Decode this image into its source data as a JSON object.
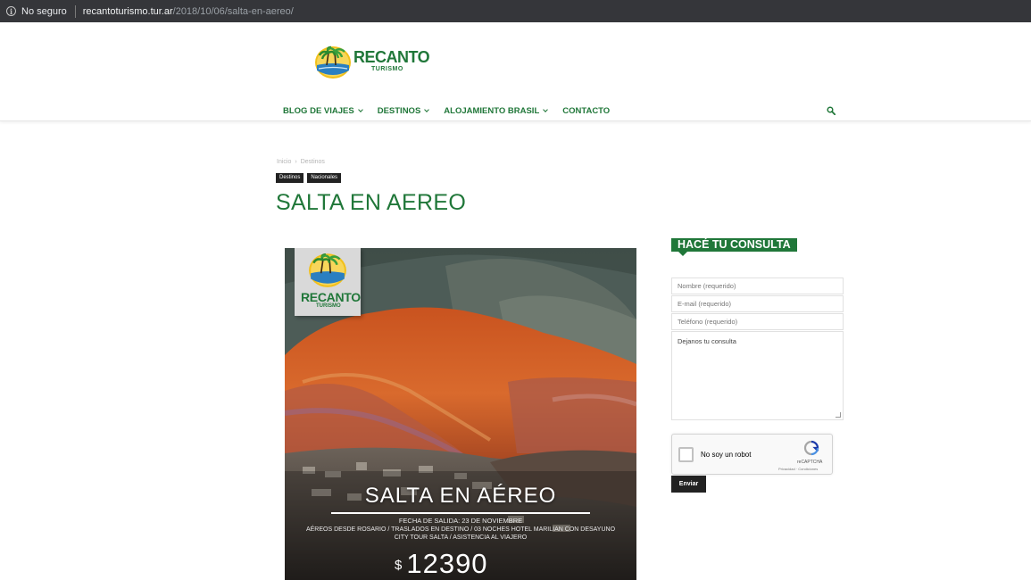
{
  "browser": {
    "security_label": "No seguro",
    "url_host": "recantoturismo.tur.ar",
    "url_path": "/2018/10/06/salta-en-aereo/"
  },
  "header": {
    "logo_word": "RECANTO",
    "logo_sub": "TURISMO",
    "nav": [
      {
        "label": "BLOG DE VIAJES",
        "has_dropdown": true
      },
      {
        "label": "DESTINOS",
        "has_dropdown": true
      },
      {
        "label": "ALOJAMIENTO BRASIL",
        "has_dropdown": true
      },
      {
        "label": "CONTACTO",
        "has_dropdown": false
      }
    ],
    "search_icon": "search-icon"
  },
  "article": {
    "breadcrumb": [
      "Inicio",
      "Destinos"
    ],
    "breadcrumb_sep": "›",
    "tags": [
      "Destinos",
      "Nacionales"
    ],
    "title": "SALTA EN AEREO"
  },
  "promo": {
    "logo_word": "RECANTO",
    "logo_sub": "TURISMO",
    "title": "SALTA EN AÉREO",
    "date": "FECHA DE SALIDA: 23 DE NOVIEMBRE",
    "details_1": "AÉREOS DESDE ROSARIO / TRASLADOS EN DESTINO / 03 NOCHES HOTEL MARILIAN CON DESAYUNO",
    "details_2": "CITY TOUR SALTA / ASISTENCIA AL VIAJERO",
    "currency": "$",
    "price": "12390"
  },
  "form": {
    "heading": "HACÉ TU CONSULTA",
    "name_placeholder": "Nombre (requerido)",
    "email_placeholder": "E-mail (requerido)",
    "phone_placeholder": "Teléfono (requerido)",
    "message_placeholder": "Dejanos tu consulta",
    "captcha_label": "No soy un robot",
    "captcha_brand": "reCAPTCHA",
    "captcha_terms": "Privacidad · Condiciones",
    "submit_label": "Enviar"
  },
  "colors": {
    "brand_green": "#207739",
    "topbar": "#35363a",
    "tag_bg": "#222222"
  }
}
